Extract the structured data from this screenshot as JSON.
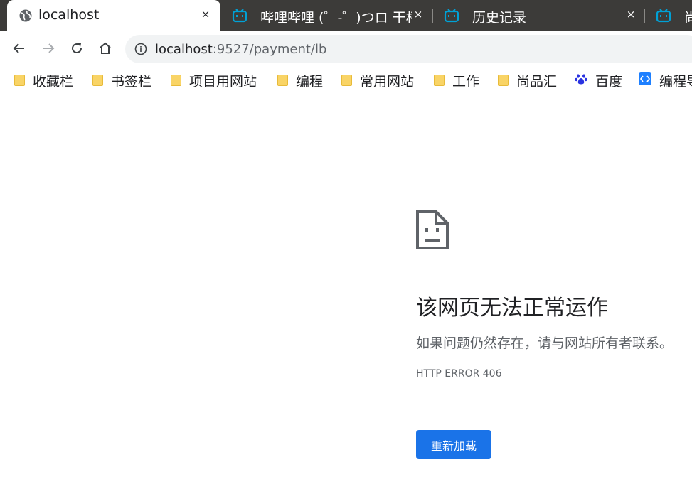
{
  "tabs": [
    {
      "title": "localhost",
      "icon": "globe-icon",
      "close": "×",
      "active": true
    },
    {
      "title": "哔哩哔哩 (゜-゜)つロ 干杯",
      "icon": "bilibili-icon",
      "close": "×",
      "active": false
    },
    {
      "title": "历史记录",
      "icon": "bilibili-icon",
      "close": "×",
      "active": false
    },
    {
      "title": "尚硅",
      "icon": "bilibili-icon",
      "active": false
    }
  ],
  "address_bar": {
    "host": "localhost",
    "rest": ":9527/payment/lb",
    "icon": "info-icon"
  },
  "bookmarks": [
    {
      "label": "收藏栏",
      "icon": "folder-icon"
    },
    {
      "label": "书签栏",
      "icon": "folder-icon"
    },
    {
      "label": "项目用网站",
      "icon": "folder-icon"
    },
    {
      "label": "编程",
      "icon": "folder-icon"
    },
    {
      "label": "常用网站",
      "icon": "folder-icon"
    },
    {
      "label": "工作",
      "icon": "folder-icon"
    },
    {
      "label": "尚品汇",
      "icon": "folder-icon"
    },
    {
      "label": "百度",
      "icon": "baidu-paw-icon"
    },
    {
      "label": "编程导航",
      "icon": "code-nav-icon"
    }
  ],
  "error_page": {
    "icon": "sad-page-icon",
    "heading": "该网页无法正常运作",
    "description": "如果问题仍然存在，请与网站所有者联系。",
    "error_code": "HTTP ERROR 406",
    "reload_label": "重新加载"
  },
  "colors": {
    "tabstrip": "#3c3b39",
    "accent": "#1a73e8",
    "bilibili": "#00a1d6"
  }
}
